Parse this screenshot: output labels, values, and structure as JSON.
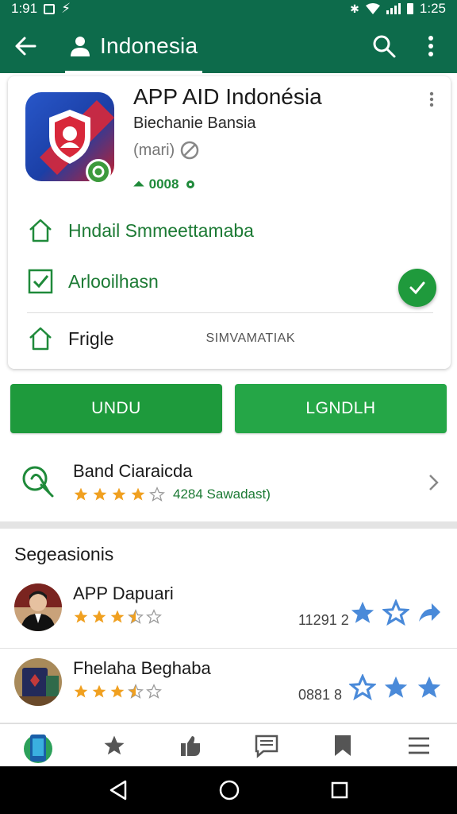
{
  "status_bar": {
    "time_left": "1:91",
    "time_right": "1:25"
  },
  "app_bar": {
    "title": "Indonesia"
  },
  "app": {
    "name": "APP AID Indonésia",
    "developer": "Biechanie Bansia",
    "meta": "(mari)",
    "size": "0008",
    "features": [
      {
        "label": "Hndail Smmeettamaba"
      },
      {
        "label": "Arlooilhasn"
      },
      {
        "label": "Frigle",
        "sub": "SIMVAMATIAK"
      }
    ]
  },
  "actions": {
    "left_label": "UNDU",
    "right_label": "LGNDLH"
  },
  "developer_row": {
    "name": "Band Ciaraicda",
    "rating_stars": 4,
    "rating_text": "4284 Sawadast)"
  },
  "section": {
    "title": "Segeasionis",
    "items": [
      {
        "name": "APP Dapuari",
        "stars": 3.5,
        "count": "11291 2"
      },
      {
        "name": "Fhelaha Beghaba",
        "stars": 3.5,
        "count": "0881 8"
      }
    ]
  },
  "colors": {
    "primary": "#0d6b4b",
    "accent": "#1e9a3c",
    "star": "#f0a020",
    "blue_star": "#4a8ad9"
  },
  "bottom_nav": [
    "home",
    "star",
    "thumbs-up",
    "comments",
    "bookmark",
    "menu"
  ]
}
